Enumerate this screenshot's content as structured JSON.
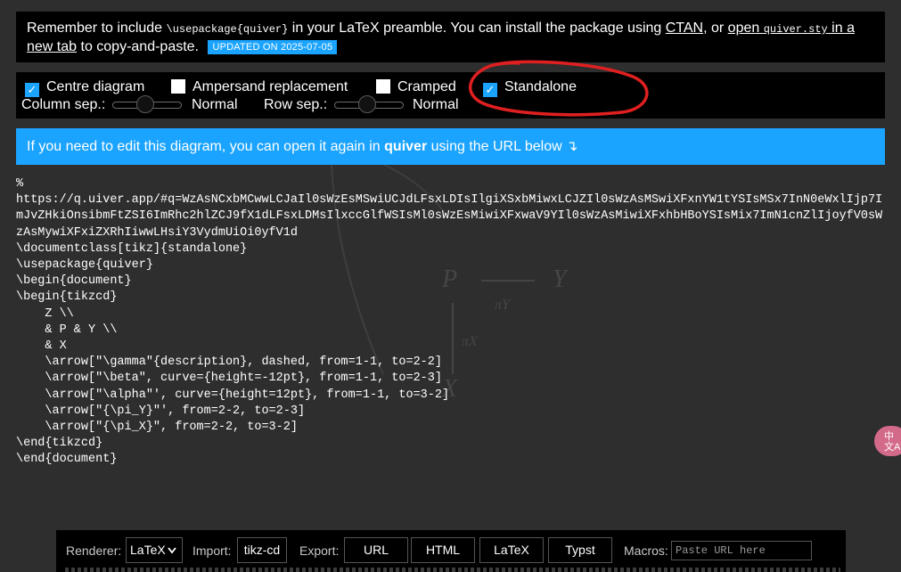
{
  "notice": {
    "text_1": "Remember to include ",
    "code_usepackage": "\\usepackage{quiver}",
    "text_2": " in your LaTeX preamble. You can install the package using ",
    "link_ctan": "CTAN",
    "text_3": ", or ",
    "link_open": "open ",
    "code_file": "quiver.sty",
    "link_new_tab": " in a new tab",
    "text_4": " to copy-and-paste.",
    "badge": "UPDATED ON 2025-07-05"
  },
  "options": {
    "centre_diagram": {
      "label": "Centre diagram",
      "checked": true
    },
    "ampersand_replacement": {
      "label": "Ampersand replacement",
      "checked": false
    },
    "cramped": {
      "label": "Cramped",
      "checked": false
    },
    "standalone": {
      "label": "Standalone",
      "checked": true
    },
    "column_sep": {
      "label": "Column sep.:",
      "value": "Normal"
    },
    "row_sep": {
      "label": "Row sep.:",
      "value": "Normal"
    },
    "check_glyph": "✓"
  },
  "info": {
    "text_1": "If you need to edit this diagram, you can open it again in ",
    "app_name": "quiver",
    "text_2": " using the URL below ",
    "arrow": "↴"
  },
  "code": "%\nhttps://q.uiver.app/#q=WzAsNCxbMCwwLCJaIl0sWzEsMSwiUCJdLFsxLDIsIlgiXSxbMiwxLCJZIl0sWzAsMSwiXFxnYW1tYSIsMSx7InN0eWxlIjp7ImJvZHkiOnsibmFtZSI6ImRhc2hlZCJ9fX1dLFsxLDMsIlxccGlfWSIsMl0sWzEsMiwiXFxwaV9YIl0sWzAsMiwiXFxhbHBoYSIsMix7ImN1cnZlIjoyfV0sWzAsMywiXFxiZXRhIiwwLHsiY3VydmUiOi0yfV1d\n\\documentclass[tikz]{standalone}\n\\usepackage{quiver}\n\\begin{document}\n\\begin{tikzcd}\n    Z \\\\\n    & P & Y \\\\\n    & X\n    \\arrow[\"\\gamma\"{description}, dashed, from=1-1, to=2-2]\n    \\arrow[\"\\beta\", curve={height=-12pt}, from=1-1, to=2-3]\n    \\arrow[\"\\alpha\"', curve={height=12pt}, from=1-1, to=3-2]\n    \\arrow[\"{\\pi_Y}\"', from=2-2, to=2-3]\n    \\arrow[\"{\\pi_X}\", from=2-2, to=3-2]\n\\end{tikzcd}\n\\end{document}",
  "translate_button": {
    "line1": "中",
    "line2": "文A"
  },
  "toolbar": {
    "renderer_label": "Renderer:",
    "renderer_value": "LaTeX",
    "import_label": "Import:",
    "import_button": "tikz-cd",
    "export_label": "Export:",
    "export_url": "URL",
    "export_html": "HTML",
    "export_latex": "LaTeX",
    "export_typst": "Typst",
    "macros_label": "Macros:",
    "macros_placeholder": "Paste URL here"
  },
  "background_diagram": {
    "labels": [
      "P",
      "Y",
      "πY",
      "πX",
      "X"
    ]
  },
  "colors": {
    "accent": "#1aa3ff",
    "annotation": "#e02020",
    "panel": "#000000",
    "page": "#2e2e2e"
  }
}
